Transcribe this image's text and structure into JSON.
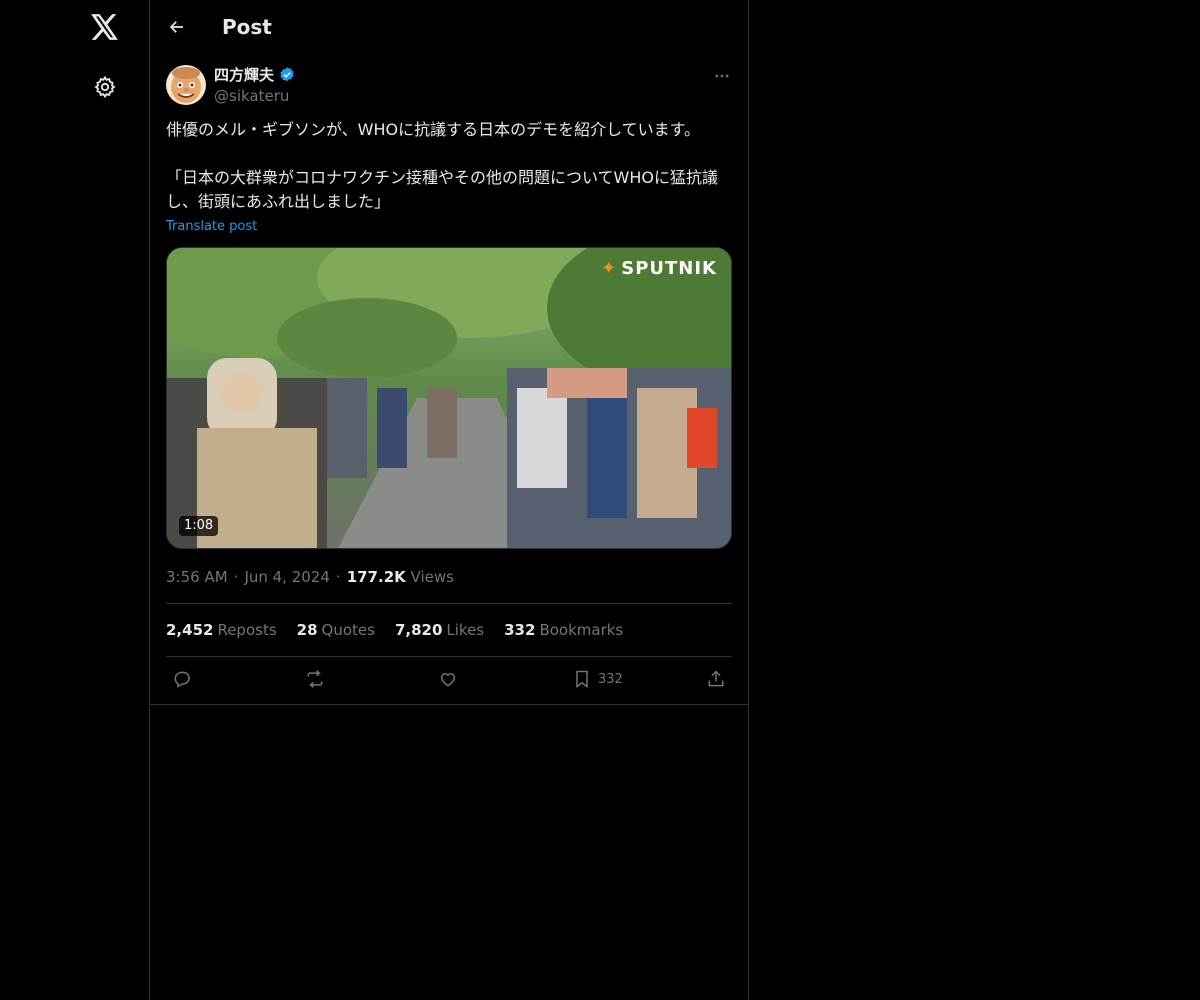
{
  "nav": {
    "logo_icon": "x-logo-icon",
    "settings_icon": "gear-icon"
  },
  "header": {
    "title": "Post",
    "back_icon": "arrow-left-icon"
  },
  "post": {
    "author": {
      "name": "四方輝夫",
      "handle": "@sikateru",
      "verified": true
    },
    "text": "俳優のメル・ギブソンが、WHOに抗議する日本のデモを紹介しています。\n\n「日本の大群衆がコロナワクチン接種やその他の問題についてWHOに猛抗議し、街頭にあふれ出しました」",
    "translate_label": "Translate post",
    "media": {
      "duration": "1:08",
      "watermark": "SPUTNIK"
    },
    "time": "3:56 AM",
    "date": "Jun 4, 2024",
    "views_count": "177.2K",
    "views_label": "Views",
    "stats": [
      {
        "count": "2,452",
        "label": "Reposts"
      },
      {
        "count": "28",
        "label": "Quotes"
      },
      {
        "count": "7,820",
        "label": "Likes"
      },
      {
        "count": "332",
        "label": "Bookmarks"
      }
    ],
    "actions": {
      "bookmark_count": "332"
    }
  },
  "colors": {
    "background": "#000000",
    "text": "#e7e9ea",
    "muted": "#71767b",
    "accent": "#1d9bf0",
    "border": "#2f3336"
  }
}
